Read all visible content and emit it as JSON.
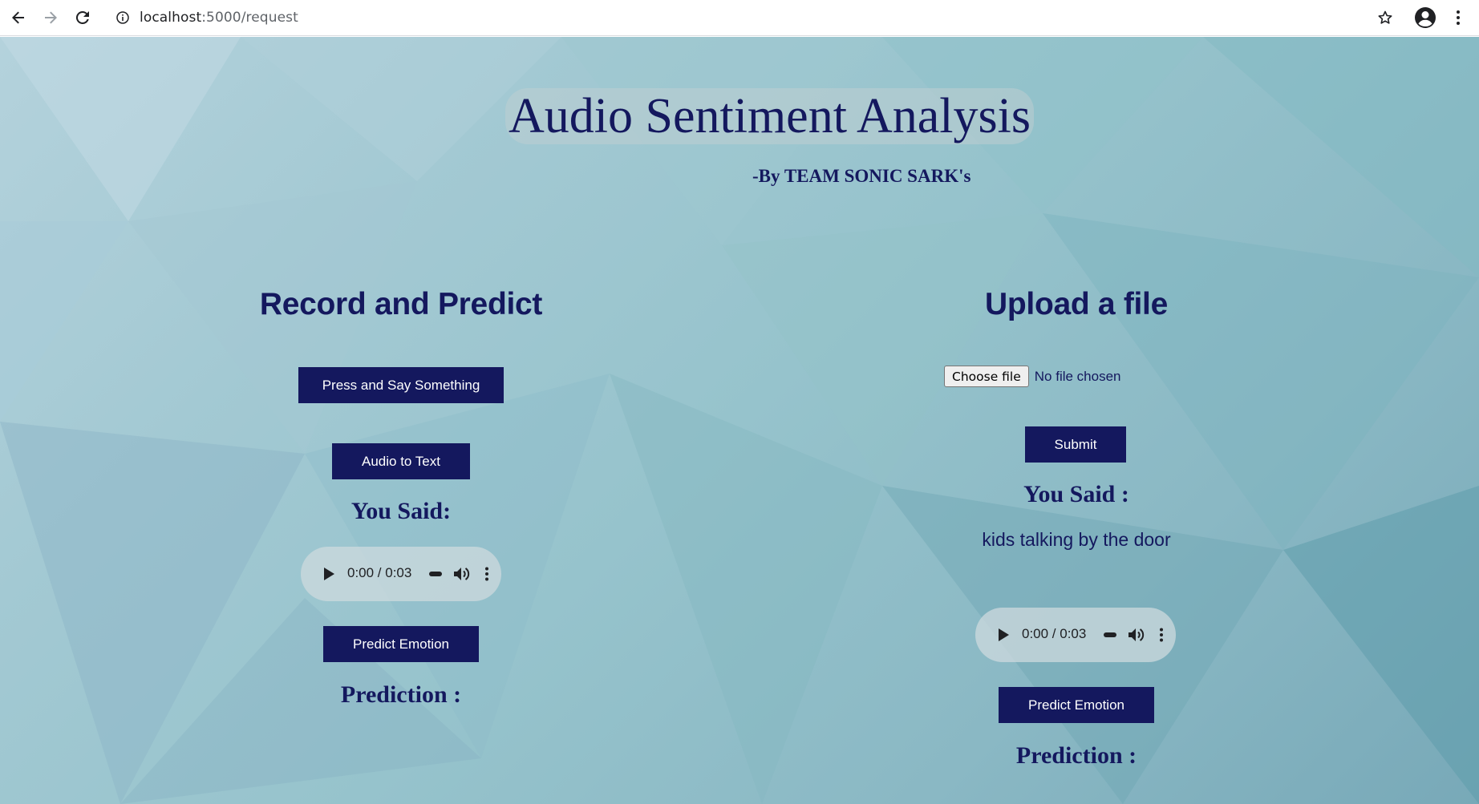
{
  "browser": {
    "url_host": "localhost",
    "url_path": ":5000/request"
  },
  "header": {
    "title": "Audio Sentiment Analysis",
    "byline": "-By TEAM SONIC SARK's"
  },
  "record": {
    "heading": "Record and Predict",
    "record_button": "Press and Say Something",
    "audio_to_text_button": "Audio to Text",
    "you_said_label": "You Said:",
    "audio_time": "0:00 / 0:03",
    "predict_button": "Predict Emotion",
    "prediction_label": "Prediction :"
  },
  "upload": {
    "heading": "Upload a file",
    "choose_file_button": "Choose file",
    "no_file_text": "No file chosen",
    "submit_button": "Submit",
    "you_said_label": "You Said :",
    "transcript": "kids talking by the door",
    "audio_time": "0:00 / 0:03",
    "predict_button": "Predict Emotion",
    "prediction_label": "Prediction :"
  },
  "colors": {
    "brand_navy": "#14185e",
    "button_text": "#ffffff"
  },
  "icons": [
    "back-icon",
    "forward-icon",
    "reload-icon",
    "info-icon",
    "star-icon",
    "account-icon",
    "kebab-menu-icon",
    "play-icon",
    "volume-icon",
    "audio-more-icon"
  ]
}
